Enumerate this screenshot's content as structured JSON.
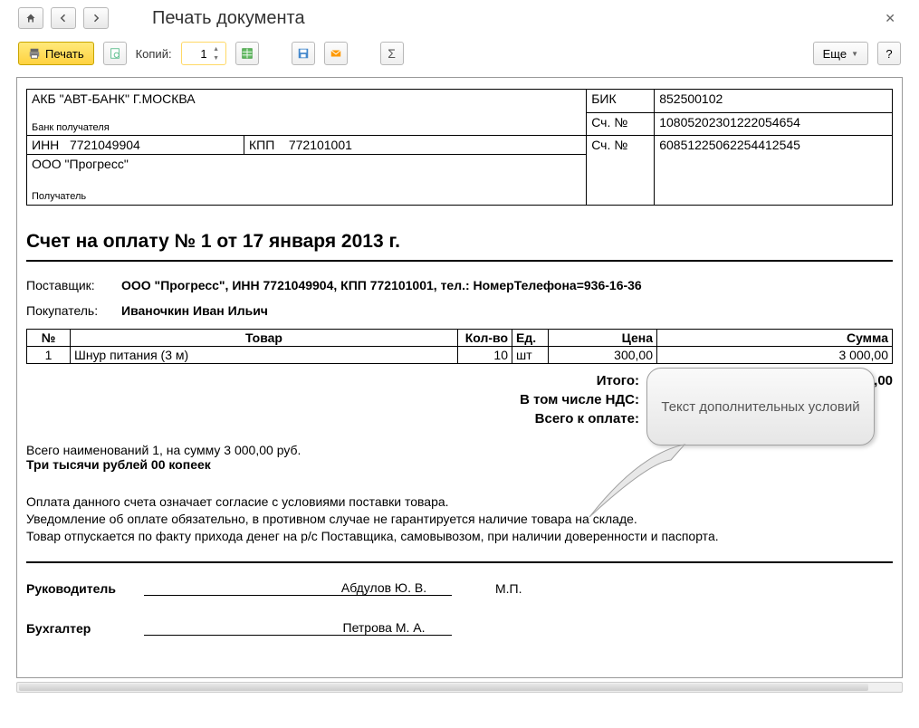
{
  "header": {
    "title": "Печать документа"
  },
  "toolbar": {
    "print_label": "Печать",
    "copies_label": "Копий:",
    "copies_value": "1",
    "more_label": "Еще",
    "help_label": "?"
  },
  "bank": {
    "name": "АКБ \"АВТ-БАНК\" Г.МОСКВА",
    "recipient_bank_label": "Банк получателя",
    "bik_label": "БИК",
    "bik_value": "852500102",
    "acc_label": "Сч. №",
    "bank_acc": "10805202301222054654",
    "inn_label": "ИНН",
    "inn_value": "7721049904",
    "kpp_label": "КПП",
    "kpp_value": "772101001",
    "payer_acc": "60851225062254412545",
    "payer_name": "ООО \"Прогресс\"",
    "recipient_label": "Получатель"
  },
  "invoice": {
    "title": "Счет на оплату № 1 от 17 января 2013 г.",
    "supplier_label": "Поставщик:",
    "supplier_value": "ООО \"Прогресс\", ИНН 7721049904, КПП 772101001,  тел.: НомерТелефона=936-16-36",
    "buyer_label": "Покупатель:",
    "buyer_value": "Иваночкин Иван Ильич"
  },
  "items": {
    "headers": {
      "num": "№",
      "name": "Товар",
      "qty": "Кол-во",
      "unit": "Ед.",
      "price": "Цена",
      "sum": "Сумма"
    },
    "rows": [
      {
        "num": "1",
        "name": "Шнур питания (3 м)",
        "qty": "10",
        "unit": "шт",
        "price": "300,00",
        "sum": "3 000,00"
      }
    ]
  },
  "totals": {
    "itogo_label": "Итого:",
    "itogo_value": "3 000,00",
    "nds_label": "В том числе НДС:",
    "nds_value": "",
    "vsego_label": "Всего к оплате:",
    "vsego_value": ""
  },
  "summary": {
    "line1": "Всего наименований 1, на сумму 3 000,00 руб.",
    "line2": "Три тысячи рублей 00 копеек"
  },
  "terms": {
    "l1": "Оплата данного счета означает согласие с условиями поставки товара.",
    "l2": "Уведомление об оплате обязательно, в противном случае не гарантируется наличие товара на складе.",
    "l3": "Товар отпускается по факту прихода денег на р/с Поставщика, самовывозом, при наличии доверенности и паспорта."
  },
  "signatures": {
    "head_label": "Руководитель",
    "head_name": "Абдулов Ю. В.",
    "mp": "М.П.",
    "acc_label": "Бухгалтер",
    "acc_name": "Петрова М. А."
  },
  "callout": "Текст дополнительных условий"
}
